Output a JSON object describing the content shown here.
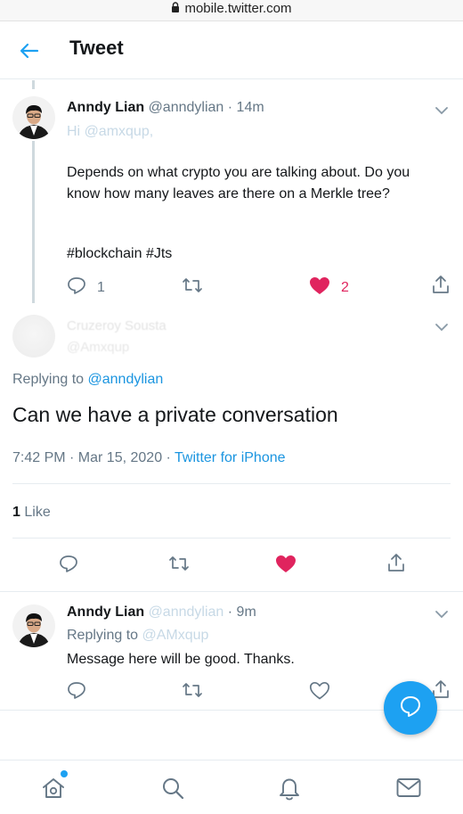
{
  "browser": {
    "url": "mobile.twitter.com",
    "lock_icon": "lock-icon"
  },
  "header": {
    "back_icon": "arrow-left-icon",
    "title": "Tweet"
  },
  "parent_tweet": {
    "name": "Anndy Lian",
    "handle": "@anndylian",
    "sep": "·",
    "time": "14m",
    "hi": "Hi",
    "mention": "@amxqup,",
    "body": "Depends on what crypto you are talking about. Do you know how many leaves are there on a Merkle tree?",
    "hashtags": "#blockchain #Jts",
    "reply_count": "1",
    "like_count": "2"
  },
  "main_tweet": {
    "name_blurred": "Cruzeroy Sousta",
    "handle_blurred": "@Amxqup",
    "replying_prefix": "Replying to",
    "replying_handle": "@anndylian",
    "text": "Can we have a private conversation",
    "timestamp": "7:42 PM · Mar 15, 2020 ·",
    "source": "Twitter for iPhone",
    "likes_count": "1",
    "likes_label": "Like"
  },
  "reply_tweet": {
    "name": "Anndy Lian",
    "handle": "@anndylian",
    "sep": "·",
    "time": "9m",
    "replying_prefix": "Replying to",
    "replying_handle": "@AMxqup",
    "body": "Message here will be good. Thanks."
  },
  "colors": {
    "accent": "#1da1f2",
    "link": "#1b95e0",
    "like_red": "#e0245e",
    "muted": "#657786"
  }
}
